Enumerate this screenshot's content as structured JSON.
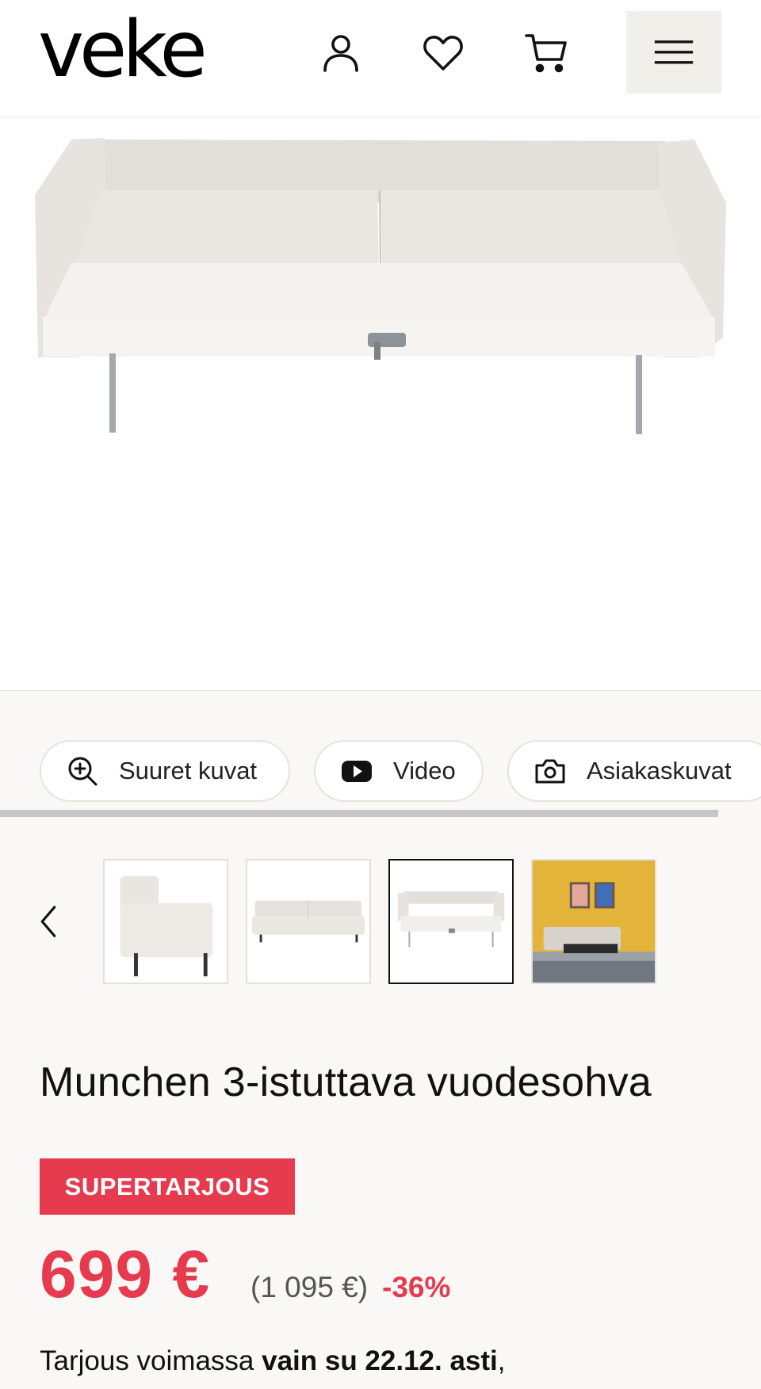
{
  "header": {
    "logo": "veke",
    "icons": [
      "user-icon",
      "heart-icon",
      "cart-icon",
      "menu-icon"
    ]
  },
  "media_buttons": [
    {
      "label": "Suuret kuvat",
      "icon": "zoom-in-icon"
    },
    {
      "label": "Video",
      "icon": "youtube-play-icon"
    },
    {
      "label": "Asiakaskuvat",
      "icon": "camera-icon"
    }
  ],
  "thumbnails": {
    "selected_index": 2,
    "count": 4
  },
  "product": {
    "title": "Munchen 3-istuttava vuodesohva",
    "badge": "SUPERTARJOUS",
    "price": "699 €",
    "old_price": "(1 095 €)",
    "discount": "-36%",
    "offer_prefix": "Tarjous voimassa ",
    "offer_bold": "vain su 22.12. asti",
    "offer_suffix": ","
  },
  "colors": {
    "accent_red": "#e63a4e",
    "background": "#f9f8f6",
    "menu_button_bg": "#f1efea",
    "selected_thumb_border": "#111111"
  }
}
